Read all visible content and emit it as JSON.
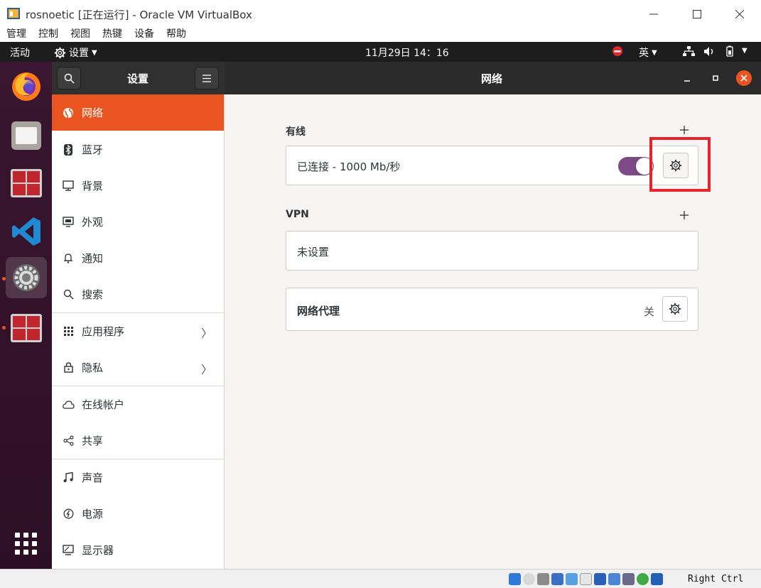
{
  "host": {
    "title": "rosnoetic [正在运行] - Oracle VM VirtualBox",
    "menu": [
      "管理",
      "控制",
      "视图",
      "热键",
      "设备",
      "帮助"
    ],
    "host_key": "Right Ctrl"
  },
  "topbar": {
    "activities": "活动",
    "app_menu": "设置",
    "datetime": "11月29日  14：16",
    "input_method": "英"
  },
  "settings": {
    "header_title": "设置",
    "panel_title": "网络",
    "sidebar": [
      {
        "label": "网络",
        "icon": "globe-icon",
        "active": true
      },
      {
        "label": "蓝牙",
        "icon": "bluetooth-icon"
      },
      {
        "label": "背景",
        "icon": "monitor-icon"
      },
      {
        "label": "外观",
        "icon": "appearance-icon"
      },
      {
        "label": "通知",
        "icon": "bell-icon"
      },
      {
        "label": "搜索",
        "icon": "search-icon"
      },
      {
        "label": "应用程序",
        "icon": "grid-icon",
        "chevron": true
      },
      {
        "label": "隐私",
        "icon": "lock-icon",
        "chevron": true
      },
      {
        "label": "在线帐户",
        "icon": "cloud-icon"
      },
      {
        "label": "共享",
        "icon": "share-icon"
      },
      {
        "label": "声音",
        "icon": "music-icon"
      },
      {
        "label": "电源",
        "icon": "power-icon"
      },
      {
        "label": "显示器",
        "icon": "display-icon"
      }
    ],
    "wired": {
      "title": "有线",
      "status": "已连接 - 1000 Mb/秒",
      "enabled": true
    },
    "vpn": {
      "title": "VPN",
      "status": "未设置"
    },
    "proxy": {
      "title": "网络代理",
      "status": "关"
    }
  },
  "colors": {
    "accent": "#e95420",
    "toggle_on": "#7c4a86",
    "highlight": "#e8232a"
  }
}
